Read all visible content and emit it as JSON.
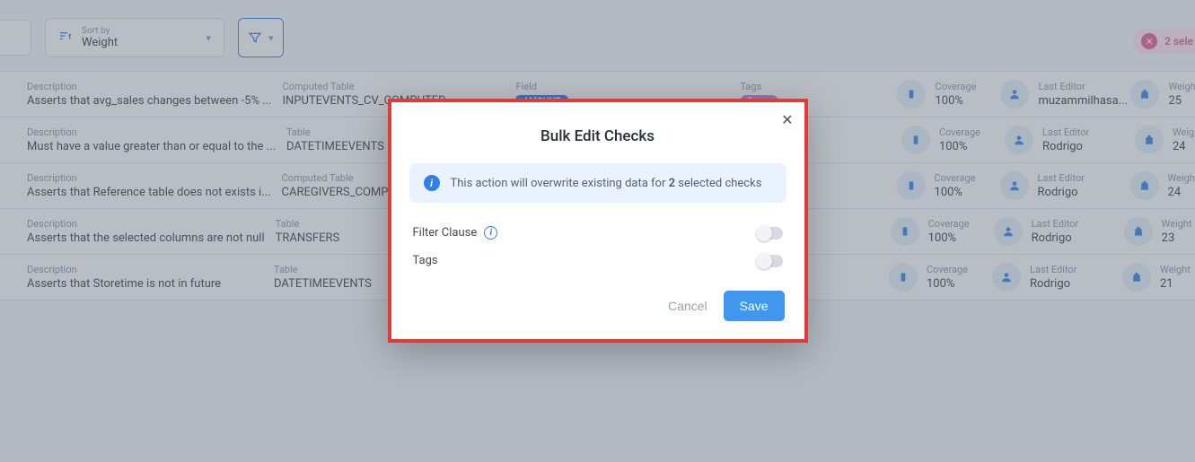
{
  "toolbar": {
    "sort_label": "Sort by",
    "sort_value": "Weight"
  },
  "selection": {
    "text": "2 sele"
  },
  "columns": {
    "description": "Description",
    "computed_table": "Computed Table",
    "table": "Table",
    "field": "Field",
    "tags": "Tags",
    "coverage": "Coverage",
    "last_editor": "Last Editor",
    "weight": "Weight"
  },
  "tags": {
    "amount": "AMOUNT",
    "demo": "Demo"
  },
  "rows": [
    {
      "description": "Asserts that avg_sales changes between -5% ...",
      "table_label_key": "computed_table",
      "table_value": "INPUTEVENTS_CV_COMPUTED",
      "show_field_tag": true,
      "show_tags_tag": true,
      "coverage": "100%",
      "editor": "muzammilhasa...",
      "weight": "25"
    },
    {
      "description": "Must have a value greater than or equal to the ...",
      "table_label_key": "table",
      "table_value": "DATETIMEEVENTS",
      "show_field_tag": false,
      "show_tags_tag": false,
      "coverage": "100%",
      "editor": "Rodrigo",
      "weight": "24"
    },
    {
      "description": "Asserts that Reference table does not exists i...",
      "table_label_key": "computed_table",
      "table_value": "CAREGIVERS_COMPUT...",
      "show_field_tag": false,
      "show_tags_tag": false,
      "coverage": "100%",
      "editor": "Rodrigo",
      "weight": "24"
    },
    {
      "description": "Asserts that the selected columns are not null",
      "table_label_key": "table",
      "table_value": "TRANSFERS",
      "show_field_tag": false,
      "show_tags_tag": false,
      "coverage": "100%",
      "editor": "Rodrigo",
      "weight": "23"
    },
    {
      "description": "Asserts that Storetime is not in future",
      "table_label_key": "table",
      "table_value": "DATETIMEEVENTS",
      "show_field_tag": false,
      "show_tags_tag": false,
      "coverage": "100%",
      "editor": "Rodrigo",
      "weight": "21"
    }
  ],
  "modal": {
    "title": "Bulk Edit Checks",
    "info_pre": "This action will overwrite existing data for ",
    "info_count": "2",
    "info_post": " selected checks",
    "filter_clause": "Filter Clause",
    "tags": "Tags",
    "cancel": "Cancel",
    "save": "Save"
  }
}
